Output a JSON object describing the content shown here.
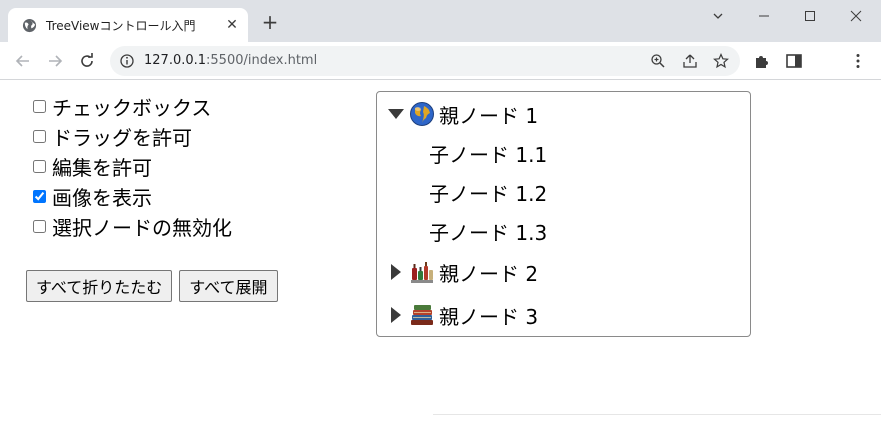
{
  "browser": {
    "tab_title": "TreeViewコントロール入門",
    "url_host": "127.0.0.1",
    "url_rest": ":5500/index.html"
  },
  "options": [
    {
      "label": "チェックボックス",
      "checked": false
    },
    {
      "label": "ドラッグを許可",
      "checked": false
    },
    {
      "label": "編集を許可",
      "checked": false
    },
    {
      "label": "画像を表示",
      "checked": true
    },
    {
      "label": "選択ノードの無効化",
      "checked": false
    }
  ],
  "buttons": {
    "collapse_all": "すべて折りたたむ",
    "expand_all": "すべて展開"
  },
  "tree": {
    "parents": [
      {
        "label": "親ノード 1",
        "expanded": true,
        "image": "globe-icon",
        "children": [
          "子ノード 1.1",
          "子ノード 1.2",
          "子ノード 1.3"
        ]
      },
      {
        "label": "親ノード 2",
        "expanded": false,
        "image": "bottles-icon",
        "children": []
      },
      {
        "label": "親ノード 3",
        "expanded": false,
        "image": "books-icon",
        "children": []
      }
    ]
  },
  "colors": {
    "checkbox_accent": "#0075ff",
    "chrome_frame": "#dee1e6",
    "omnibox_bg": "#f1f3f4"
  }
}
